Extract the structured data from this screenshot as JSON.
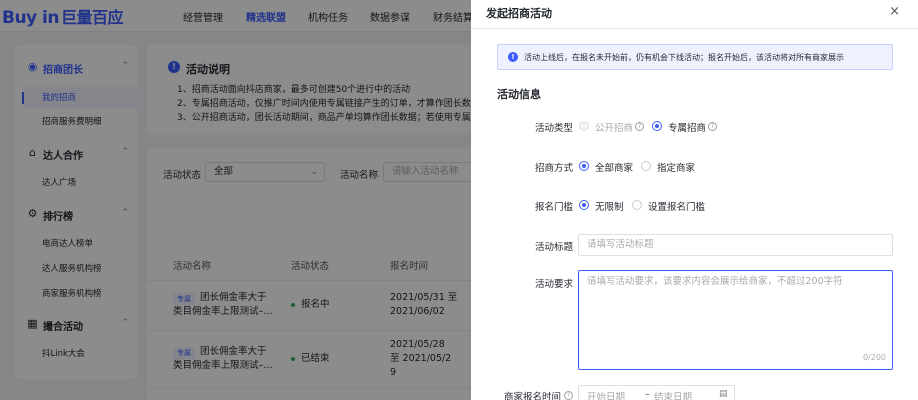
{
  "header": {
    "logo_en": "Buy in",
    "logo_cn": "巨量百应",
    "nav": [
      "经营管理",
      "精选联盟",
      "机构任务",
      "数据参谋",
      "财务结算"
    ]
  },
  "sidebar": {
    "groups": [
      {
        "label": "招商团长",
        "icon": "users-icon"
      },
      {
        "label": "达人合作",
        "icon": "handshake-icon"
      },
      {
        "label": "排行榜",
        "icon": "trophy-icon"
      },
      {
        "label": "撮合活动",
        "icon": "grid-icon"
      }
    ],
    "items": [
      "我的招商",
      "招商服务费明细",
      "达人广场",
      "电商达人榜单",
      "达人服务机构榜",
      "商家服务机构榜",
      "抖Link大会"
    ]
  },
  "info": {
    "title": "活动说明",
    "lines": [
      "1、招商活动面向抖店商家，最多可创建50个进行中的活动",
      "2、专属招商活动，仅推广时间内使用专属链接产生的订单，才算作团长数",
      "3、公开招商活动，团长活动期间，商品产单均算作团长数据；若使用专属"
    ]
  },
  "filters": {
    "status_label": "活动状态",
    "status_value": "全部",
    "name_label": "活动名称",
    "name_placeholder": "请输入活动名称"
  },
  "table": {
    "headers": [
      "活动名称",
      "活动状态",
      "报名时间"
    ],
    "rows": [
      {
        "tag": "专属",
        "name_line1": "团长佣金率大于",
        "name_line2": "类目佣金率上限测试–…",
        "status": "报名中",
        "status_color": "#2fb36a",
        "time_line1": "2021/05/31 至",
        "time_line2": "2021/06/02",
        "time_line3": ""
      },
      {
        "tag": "专属",
        "name_line1": "团长佣金率大于",
        "name_line2": "类目佣金率上限测试–…",
        "status": "已结束",
        "status_color": "#2fb36a",
        "time_line1": "2021/05/28",
        "time_line2": "至 2021/05/2",
        "time_line3": "9"
      }
    ]
  },
  "drawer": {
    "title": "发起招商活动",
    "close": "×",
    "notice": "活动上线后，在报名未开始前，仍有机会下线活动；报名开始后，该活动将对所有商家展示",
    "section": "活动信息",
    "type_label": "活动类型",
    "type_public": "公开招商",
    "type_exclusive": "专属招商",
    "method_label": "招商方式",
    "method_all": "全部商家",
    "method_specific": "指定商家",
    "threshold_label": "报名门槛",
    "threshold_none": "无限制",
    "threshold_set": "设置报名门槛",
    "title_label": "活动标题",
    "title_placeholder": "请填写活动标题",
    "req_label": "活动要求",
    "req_placeholder": "请填写活动要求，该要求内容会展示给商家，不超过200字符",
    "req_counter": "0/200",
    "time_label": "商家报名时间",
    "start_placeholder": "开始日期",
    "end_placeholder": "结束日期",
    "date_sep": "–"
  },
  "colors": {
    "accent": "#3d5dff",
    "success": "#2fb36a"
  }
}
